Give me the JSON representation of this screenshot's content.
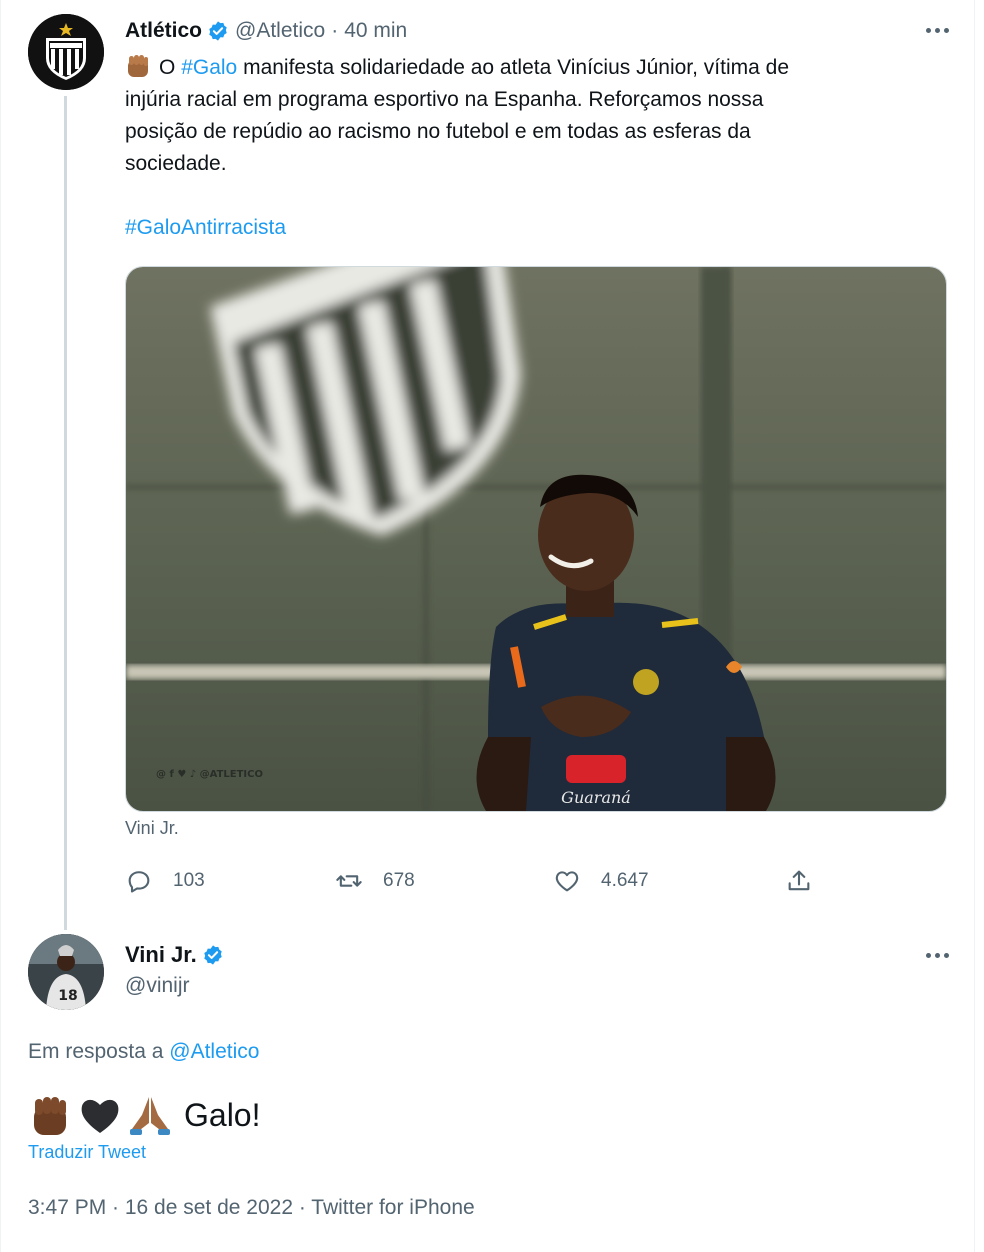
{
  "tweet1": {
    "display_name": "Atlético",
    "handle": "@Atletico",
    "separator": "·",
    "time": "40 min",
    "text_prefix": "O",
    "hashtag_galo": "#Galo",
    "text_line1_rest": "manifesta solidariedade ao atleta Vinícius Júnior, vítima de",
    "text_line2": "injúria racial em programa esportivo na Espanha. Reforçamos nossa",
    "text_line3": "posição de repúdio ao racismo no futebol e em todas as esferas da",
    "text_line4": "sociedade.",
    "hashtag_antirracista": "#GaloAntirracista",
    "media_watermark": "@ f ♥ ♪ @ATLETICO",
    "media_caption": "Vini Jr.",
    "replies": "103",
    "retweets": "678",
    "likes": "4.647",
    "icons": [
      "verified-icon",
      "more-icon",
      "reply-icon",
      "retweet-icon",
      "like-icon",
      "share-icon",
      "raised-fist-emoji"
    ]
  },
  "tweet2": {
    "display_name": "Vini Jr.",
    "handle": "@vinijr",
    "reply_prefix": "Em resposta a",
    "reply_handle": "@Atletico",
    "body_text": "Galo!",
    "emojis": [
      "raised-fist-emoji",
      "black-heart-emoji",
      "folded-hands-emoji"
    ],
    "translate_label": "Traduzir Tweet",
    "meta": "3:47 PM · 16 de set de 2022 · Twitter for iPhone"
  },
  "colors": {
    "link": "#1d9bf0",
    "muted": "#536471",
    "text": "#0f1419",
    "verified": "#1d9bf0"
  }
}
